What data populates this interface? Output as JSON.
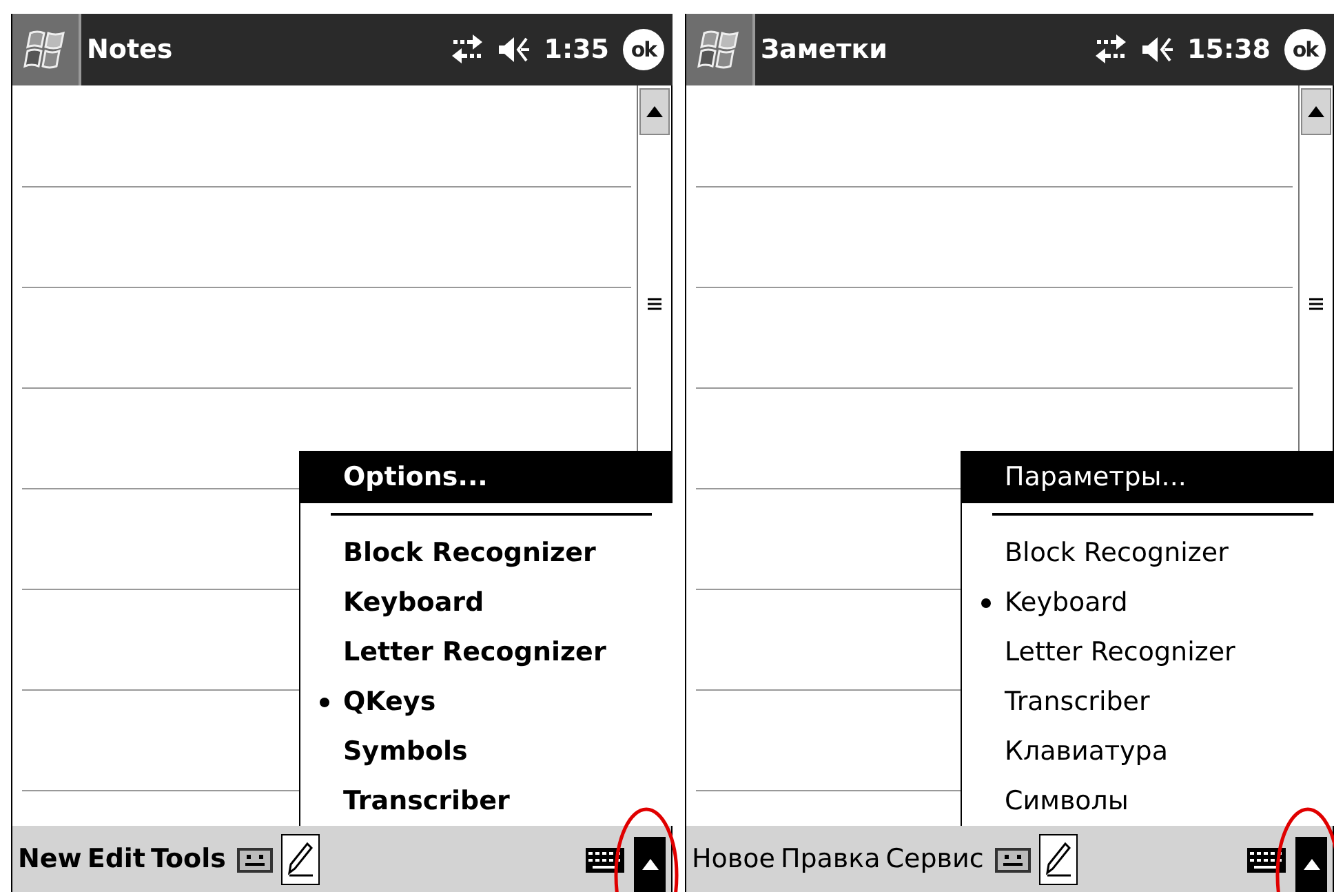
{
  "panels": [
    {
      "title": "Notes",
      "time": "1:35",
      "ok": "ok",
      "menu": {
        "header": "Options...",
        "items": [
          {
            "label": "Block Recognizer",
            "selected": false
          },
          {
            "label": "Keyboard",
            "selected": false
          },
          {
            "label": "Letter Recognizer",
            "selected": false
          },
          {
            "label": "QKeys",
            "selected": true
          },
          {
            "label": "Symbols",
            "selected": false
          },
          {
            "label": "Transcriber",
            "selected": false
          }
        ]
      },
      "menubar": [
        "New",
        "Edit",
        "Tools"
      ],
      "arrow_highlighted": true
    },
    {
      "title": "Заметки",
      "time": "15:38",
      "ok": "ok",
      "menu": {
        "header": "Параметры...",
        "items": [
          {
            "label": "Block Recognizer",
            "selected": false
          },
          {
            "label": "Keyboard",
            "selected": true
          },
          {
            "label": "Letter Recognizer",
            "selected": false
          },
          {
            "label": "Transcriber",
            "selected": false
          },
          {
            "label": "Клавиатура",
            "selected": false
          },
          {
            "label": "Символы",
            "selected": false
          }
        ]
      },
      "menubar": [
        "Новое",
        "Правка",
        "Сервис"
      ],
      "arrow_highlighted": true
    }
  ]
}
